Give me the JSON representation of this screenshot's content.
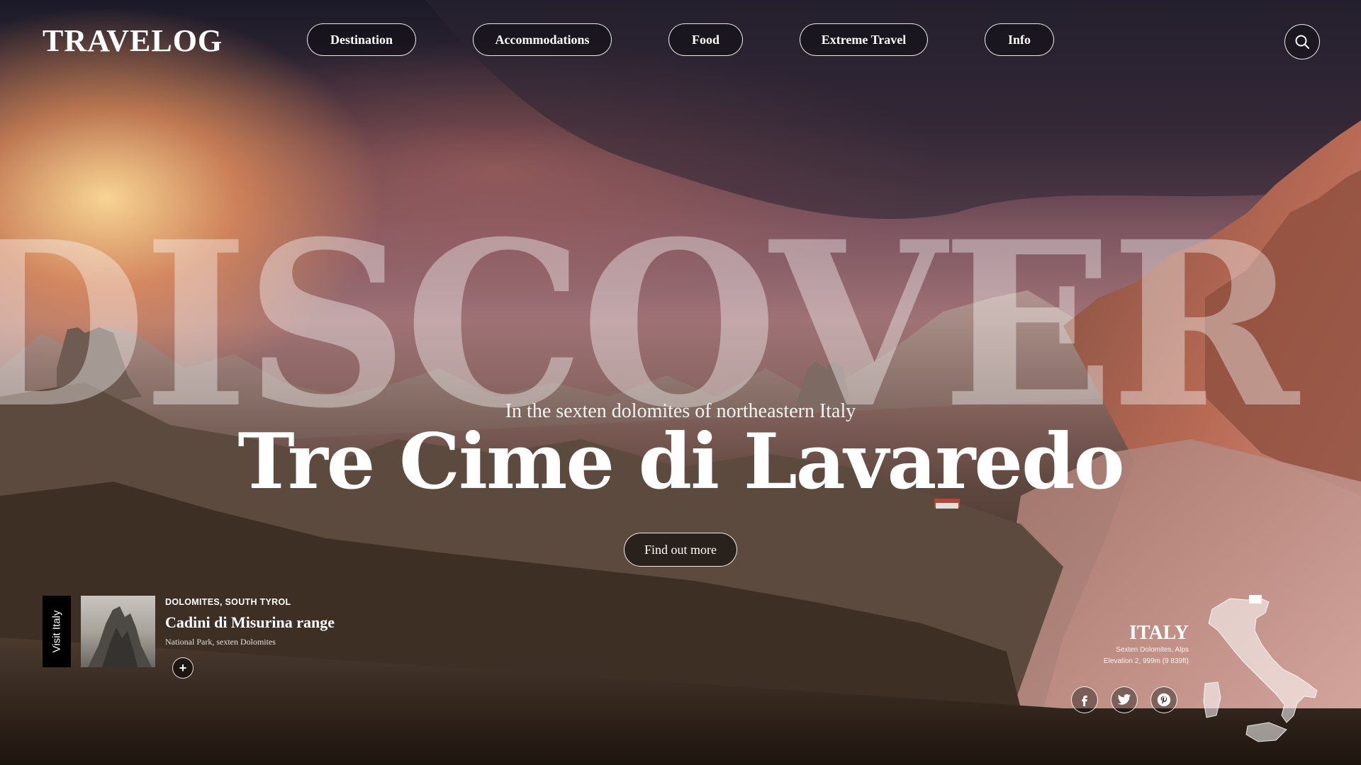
{
  "brand": {
    "logo": "TRAVELOG"
  },
  "nav": {
    "items": [
      {
        "label": "Destination"
      },
      {
        "label": "Accommodations"
      },
      {
        "label": "Food"
      },
      {
        "label": "Extreme Travel"
      },
      {
        "label": "Info"
      }
    ],
    "search_icon": "search-icon"
  },
  "hero": {
    "background_word": "DISCOVER",
    "subtitle": "In the sexten dolomites of northeastern Italy",
    "title": "Tre Cime di Lavaredo",
    "cta_label": "Find out more"
  },
  "feature_card": {
    "tab_label": "Visit Italy",
    "kicker": "DOLOMITES, SOUTH TYROL",
    "title": "Cadini di Misurina range",
    "subtitle": "National Park, sexten Dolomites",
    "add_icon": "plus-icon"
  },
  "location": {
    "country": "ITALY",
    "line1": "Sexten Dolomites, Alps",
    "line2": "Elevation 2, 999m (9 839ft)",
    "map_icon": "italy-map-icon"
  },
  "social": [
    {
      "icon": "facebook-icon"
    },
    {
      "icon": "twitter-icon"
    },
    {
      "icon": "pinterest-icon"
    }
  ],
  "colors": {
    "button_fill": "#000000",
    "text": "#ffffff"
  }
}
